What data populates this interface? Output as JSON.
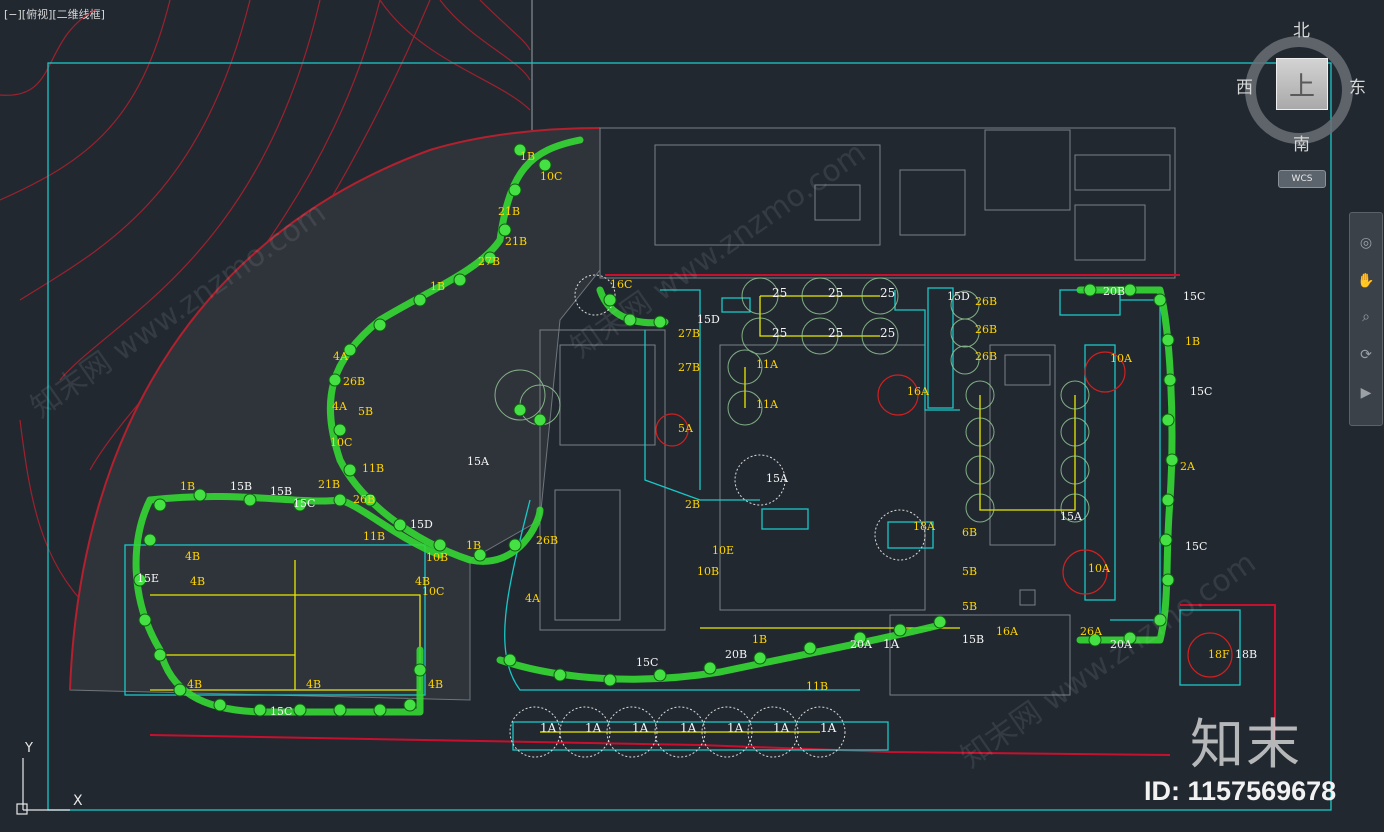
{
  "viewport": {
    "label": "[−][俯视][二维线框]"
  },
  "viewcube": {
    "north": "北",
    "south": "南",
    "east": "东",
    "west": "西",
    "face": "上",
    "wcs": "WCS"
  },
  "navbar": {
    "icons": [
      "steering-wheel-icon",
      "pan-icon",
      "zoom-icon",
      "orbit-icon",
      "showmotion-icon"
    ]
  },
  "ucs": {
    "y": "Y",
    "x": "X"
  },
  "watermark": {
    "brand": "知末",
    "id": "ID: 1157569678",
    "site": "知末网 www.znzmo.com"
  },
  "colors": {
    "background": "#212830",
    "frame": "#19c7c7",
    "tree": "#3cd23c",
    "label": "#ffd400",
    "boundary": "#c8102e",
    "building": "#8a8f95"
  },
  "plant_labels": [
    "1B",
    "21B",
    "10C",
    "21B",
    "27B",
    "1B",
    "4A",
    "26B",
    "4A",
    "5B",
    "10C",
    "15A",
    "11B",
    "1B",
    "15B",
    "15C",
    "21B",
    "26B",
    "4B",
    "15D",
    "11B",
    "10B",
    "4A",
    "1B",
    "26B",
    "16C",
    "15D",
    "27B",
    "5A",
    "27B",
    "25",
    "25",
    "25",
    "25",
    "25",
    "25",
    "11A",
    "11A",
    "16A",
    "15A",
    "2B",
    "10E",
    "10B",
    "18A",
    "15D",
    "26B",
    "26B",
    "26B",
    "20B",
    "15C",
    "1B",
    "10A",
    "15C",
    "2A",
    "15C",
    "10A",
    "15A",
    "26A",
    "20A",
    "18F",
    "18B",
    "15B",
    "20A",
    "1A",
    "4B",
    "20B",
    "4B",
    "15C",
    "11B",
    "1A",
    "1A",
    "1A",
    "1A",
    "1A",
    "1A",
    "1A",
    "15E",
    "4B",
    "15C",
    "4B",
    "10C",
    "4B",
    "1B",
    "15B",
    "6B",
    "5B",
    "5B",
    "16A"
  ]
}
